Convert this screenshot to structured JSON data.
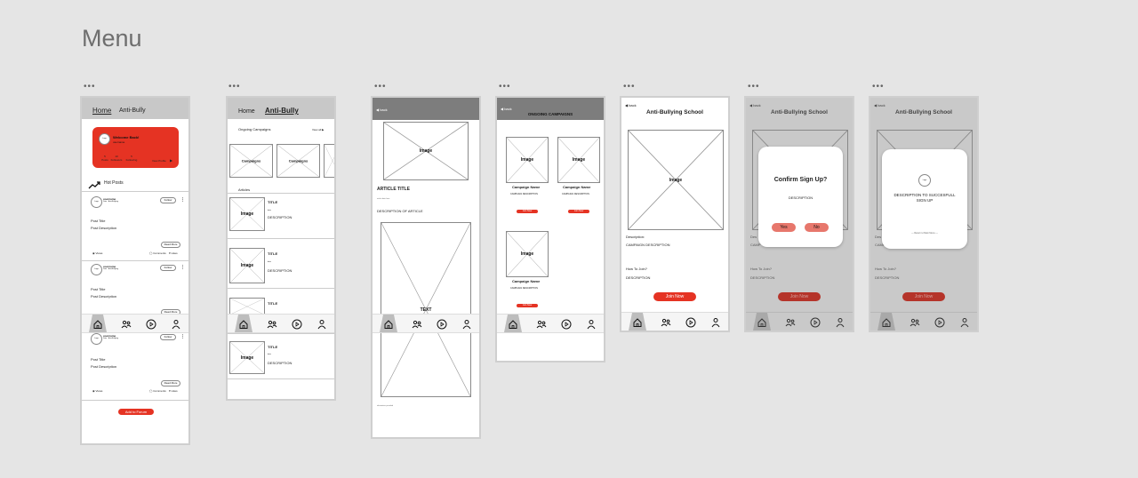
{
  "title": "Menu",
  "nav_icons": [
    "home-icon",
    "community-icon",
    "play-icon",
    "profile-icon"
  ],
  "colors": {
    "accent": "#e53323",
    "header_gray": "#7d7d7d",
    "canvas": "#e5e5e5"
  },
  "s1": {
    "tab_home": "Home",
    "tab_anti": "Anti-Bully",
    "welcome": "Welcome Back!",
    "username": "username",
    "stats": [
      {
        "num": "5",
        "label": "Posts"
      },
      {
        "num": "10",
        "label": "Followers"
      },
      {
        "num": "5",
        "label": "Following"
      }
    ],
    "view_profile": "View Profile",
    "hot_posts": "Hot Posts",
    "logo": "Logo",
    "post_user": "username",
    "post_sub": "Date · Anti-Bullying",
    "follow": "Follow",
    "post_title": "Post Title",
    "post_desc": "Post Description",
    "read_more": "Read More",
    "views": "Views",
    "comments": "Comments",
    "likes": "Likes",
    "add_forum": "Add to Forum"
  },
  "s2": {
    "tab_home": "Home",
    "tab_anti": "Anti-Bully",
    "ongoing": "Ongoing Campaigns",
    "view_all": "View all",
    "campaigns": "Campaigns",
    "articles": "Articles",
    "image": "Image",
    "title": "TITLE",
    "date": "date",
    "description": "DESCRIPTION"
  },
  "s3": {
    "back": "back",
    "image": "Image",
    "article_title": "ARTICLE TITLE",
    "article_date": "article date here",
    "article_desc": "DESCRIPTION OF ARTICLE",
    "text": "TEXT",
    "footer": "information provided"
  },
  "s4": {
    "back": "back",
    "header": "ONGOING CAMPAIGNS",
    "image": "Image",
    "campaign_name": "Campaign Name",
    "campaign_desc": "CAMPAIGN DESCRIPTION",
    "join": "Join Now"
  },
  "s5": {
    "back": "back",
    "title": "Anti-Bullying School",
    "image": "Image",
    "description_label": "Description:",
    "campaign_desc": "CAMPAIGN DESCRIPTION",
    "how_to_join": "How To Join?",
    "description": "DESCRIPTION",
    "join": "Join Now"
  },
  "s6": {
    "back": "back",
    "title": "Anti-Bullying School",
    "confirm": "Confirm Sign Up?",
    "description": "DESCRIPTION",
    "yes": "Yes",
    "no": "No",
    "join": "Join Now",
    "bg_desc": "Des",
    "bg_camp": "CAMP",
    "how_to_join": "How To Join?",
    "bg_description": "DESCRIPTION"
  },
  "s7": {
    "back": "back",
    "title": "Anti-Bullying School",
    "logo": "Logo",
    "success": "DESCRIPTION TO SUCCESFULL SIGN UP",
    "return": "— Return to Main Menu —",
    "join": "Join Now",
    "bg_desc": "Des",
    "bg_camp": "CAMP",
    "how_to_join": "How To Join?",
    "bg_description": "DESCRIPTION"
  }
}
